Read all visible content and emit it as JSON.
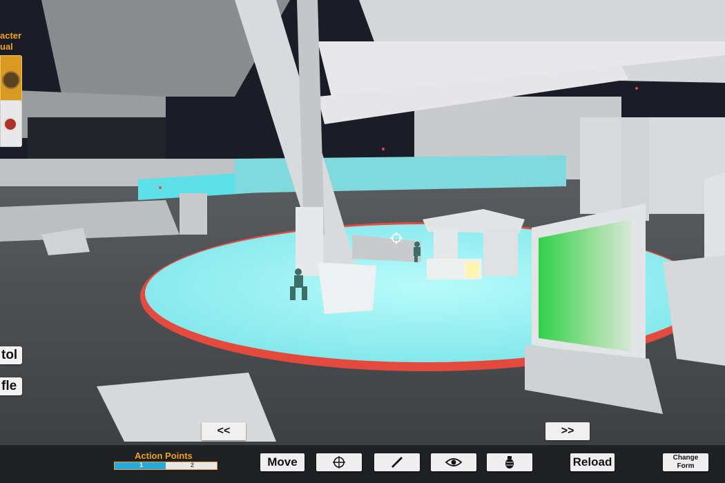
{
  "character_panel": {
    "label": "acter\nual"
  },
  "weapons": [
    {
      "label": "tol"
    },
    {
      "label": "fle"
    }
  ],
  "navigation": {
    "prev_label": "<<",
    "next_label": ">>"
  },
  "action_points": {
    "label": "Action Points",
    "current": 1,
    "max": 2,
    "tick_1": "1",
    "tick_2": "2",
    "fill_fraction": 0.5
  },
  "actions": {
    "move_label": "Move",
    "aim_icon": "crosshair-icon",
    "melee_icon": "knife-icon",
    "overwatch_icon": "eye-icon",
    "grenade_icon": "grenade-icon",
    "reload_label": "Reload",
    "change_form_label": "Change\nForm"
  },
  "colors": {
    "accent": "#f0a020",
    "ap_fill": "#2aa8d8",
    "zone_cyan": "#8ff0f0",
    "zone_edge": "#ff4a3a",
    "cover_green": "#40e060"
  }
}
